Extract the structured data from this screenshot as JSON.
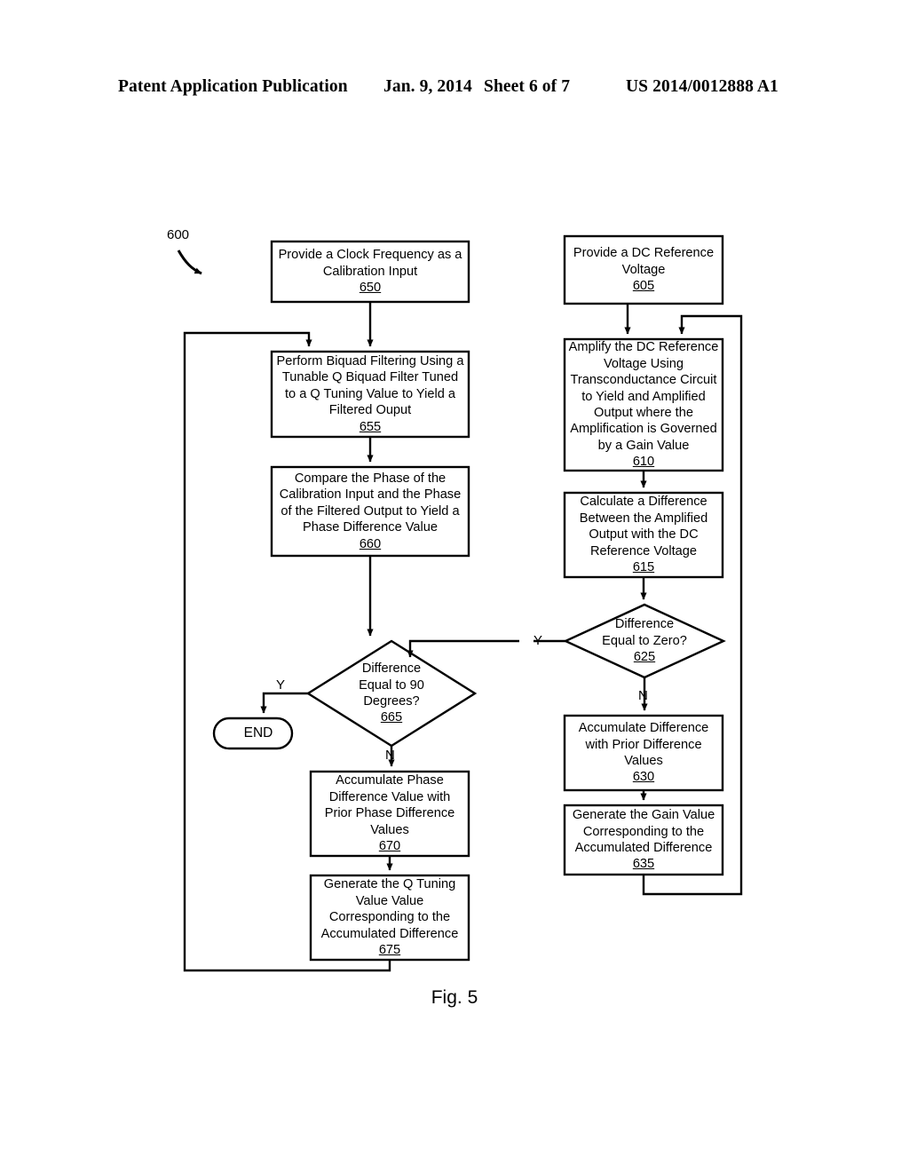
{
  "header": {
    "publication": "Patent Application Publication",
    "date": "Jan. 9, 2014",
    "sheet": "Sheet 6 of 7",
    "patent_number": "US 2014/0012888 A1"
  },
  "figure": {
    "caption": "Fig. 5",
    "diagram_reference": "600"
  },
  "flowchart": {
    "nodes": [
      {
        "id": "650",
        "shape": "process",
        "text": "Provide a Clock Frequency as a\nCalibration Input",
        "ref": "650"
      },
      {
        "id": "605",
        "shape": "process",
        "text": "Provide a DC Reference\nVoltage",
        "ref": "605"
      },
      {
        "id": "655",
        "shape": "process",
        "text": "Perform Biquad Filtering Using a\nTunable Q Biquad Filter Tuned\nto a Q Tuning Value to Yield a\nFiltered Ouput",
        "ref": "655"
      },
      {
        "id": "610",
        "shape": "process",
        "text": "Amplify the DC Reference\nVoltage Using\nTransconductance Circuit\nto Yield and Amplified\nOutput where the\nAmplification is Governed\nby a Gain Value",
        "ref": "610"
      },
      {
        "id": "660",
        "shape": "process",
        "text": "Compare the Phase of the\nCalibration Input and the Phase\nof the Filtered Output to Yield a\nPhase Difference Value",
        "ref": "660"
      },
      {
        "id": "615",
        "shape": "process",
        "text": "Calculate a Difference\nBetween the Amplified\nOutput with the DC\nReference Voltage",
        "ref": "615"
      },
      {
        "id": "625",
        "shape": "decision",
        "text": "Difference\nEqual to Zero?",
        "ref": "625"
      },
      {
        "id": "665",
        "shape": "decision",
        "text": "Difference\nEqual to 90\nDegrees?",
        "ref": "665"
      },
      {
        "id": "end",
        "shape": "terminator",
        "text": "END",
        "ref": ""
      },
      {
        "id": "630",
        "shape": "process",
        "text": "Accumulate Difference\nwith Prior Difference\nValues",
        "ref": "630"
      },
      {
        "id": "670",
        "shape": "process",
        "text": "Accumulate Phase\nDifference Value with\nPrior Phase Difference\nValues",
        "ref": "670"
      },
      {
        "id": "635",
        "shape": "process",
        "text": "Generate the Gain Value\nCorresponding to the\nAccumulated Difference",
        "ref": "635"
      },
      {
        "id": "675",
        "shape": "process",
        "text": "Generate the Q Tuning\nValue Value\nCorresponding to the\nAccumulated Difference",
        "ref": "675"
      }
    ],
    "edge_labels": {
      "decision_625_yes": "Y",
      "decision_625_no": "N",
      "decision_665_yes": "Y",
      "decision_665_no": "N"
    }
  },
  "colors": {
    "ink": "#000000",
    "paper": "#ffffff"
  }
}
